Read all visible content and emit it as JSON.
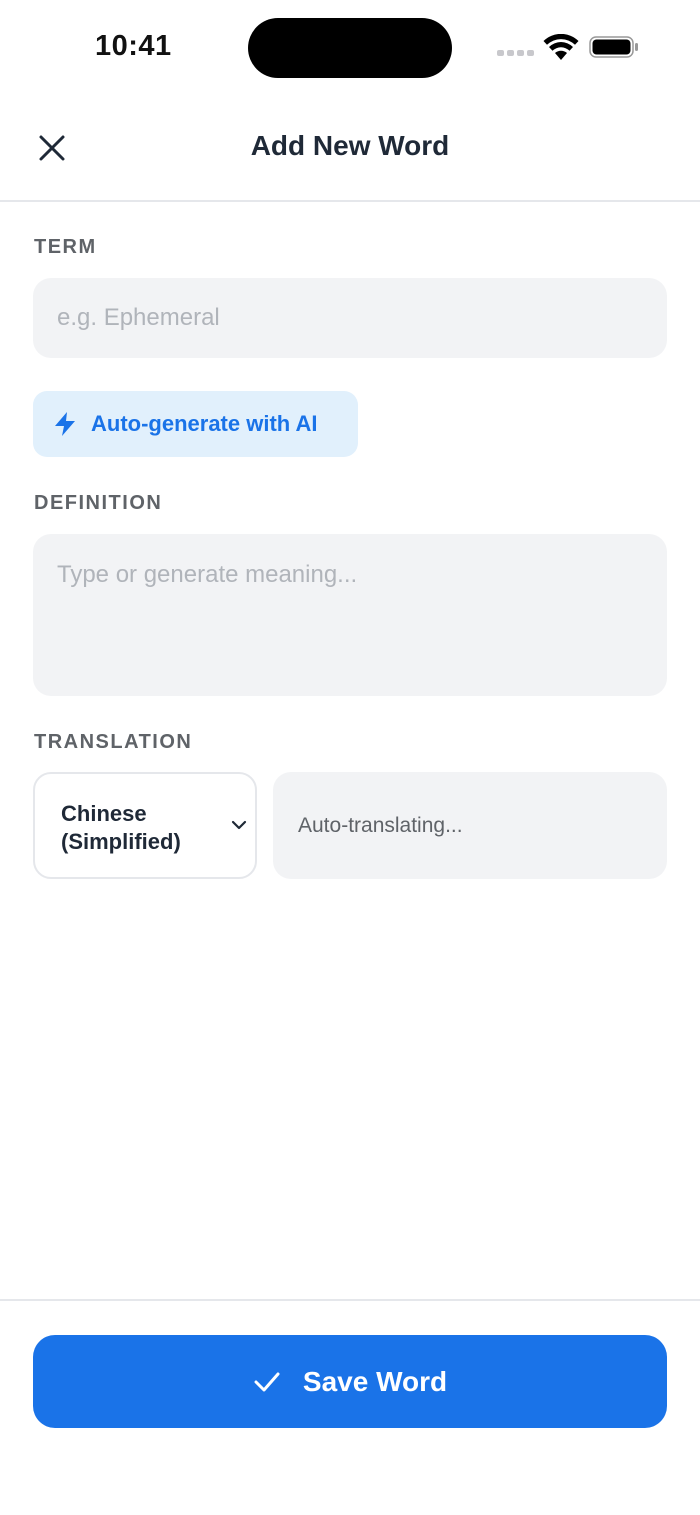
{
  "status_bar": {
    "time": "10:41"
  },
  "header": {
    "title": "Add New Word"
  },
  "form": {
    "term": {
      "label": "TERM",
      "value": "",
      "placeholder": "e.g. Ephemeral"
    },
    "ai_button": {
      "label": "Auto-generate with AI",
      "icon": "lightning-icon"
    },
    "definition": {
      "label": "DEFINITION",
      "value": "",
      "placeholder": "Type or generate meaning..."
    },
    "translation": {
      "label": "TRANSLATION",
      "language": "Chinese (Simplified)",
      "status": "Auto-translating..."
    }
  },
  "footer": {
    "save_label": "Save Word",
    "icon": "check-icon"
  },
  "colors": {
    "accent": "#1a73e8",
    "accent_light": "#e1f0fc",
    "field_bg": "#f2f3f5"
  }
}
